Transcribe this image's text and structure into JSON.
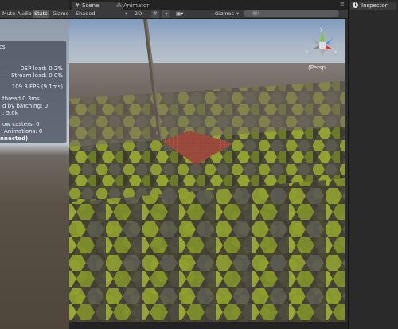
{
  "game_panel": {
    "toolbar": {
      "mute_audio": "Mute Audio",
      "stats": "Stats",
      "gizmos": "Gizmo"
    },
    "stats": {
      "header": "cs",
      "dsp_load": "DSP load: 0.2%",
      "stream_load": "Stream load: 0.0%",
      "fps": "109.3 FPS (9.1ms)",
      "thread": "thread 0.3ms",
      "batching": "d by batching: 0",
      "tris": ": 5.0k",
      "shadow_casters": "ow casters: 0",
      "animations": "Animations: 0",
      "connected": "nnected)"
    }
  },
  "tabs": {
    "scene": "Scene",
    "animator": "Animator"
  },
  "scene_toolbar": {
    "shading": "Shaded",
    "mode_2d": "2D",
    "gizmos": "Gizmos",
    "search_placeholder": "All"
  },
  "scene_view": {
    "projection": "Persp",
    "gizmo_axes": [
      "y",
      "x",
      "z"
    ]
  },
  "inspector": {
    "tab_label": "Inspector"
  },
  "colors": {
    "gizmo_x": "#d8342c",
    "gizmo_y": "#7cc53a",
    "gizmo_z": "#3a7fd8",
    "grass": "#8a9a2c",
    "stone": "#4a473f",
    "plane_red": "#9a4a3c"
  }
}
